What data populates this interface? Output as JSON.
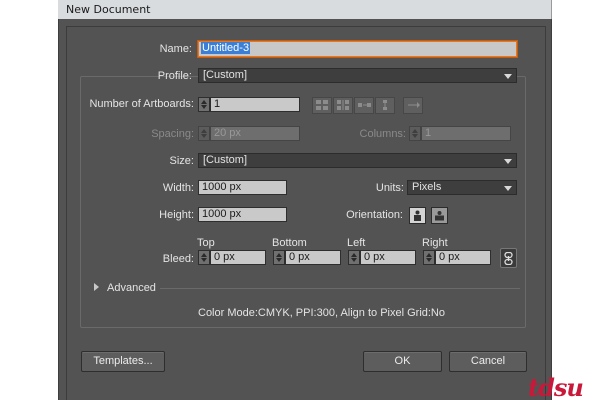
{
  "window": {
    "title": "New Document"
  },
  "name": {
    "label": "Name:",
    "value": "Untitled-3"
  },
  "profile": {
    "label": "Profile:",
    "value": "[Custom]"
  },
  "artboards": {
    "label": "Number of Artboards:",
    "value": "1",
    "spacing_label": "Spacing:",
    "spacing_value": "20 px",
    "columns_label": "Columns:",
    "columns_value": "1"
  },
  "size": {
    "label": "Size:",
    "value": "[Custom]"
  },
  "width": {
    "label": "Width:",
    "value": "1000 px"
  },
  "units": {
    "label": "Units:",
    "value": "Pixels"
  },
  "height": {
    "label": "Height:",
    "value": "1000 px"
  },
  "orientation": {
    "label": "Orientation:"
  },
  "bleed": {
    "label": "Bleed:",
    "top_label": "Top",
    "top_value": "0 px",
    "bottom_label": "Bottom",
    "bottom_value": "0 px",
    "left_label": "Left",
    "left_value": "0 px",
    "right_label": "Right",
    "right_value": "0 px"
  },
  "advanced": {
    "label": "Advanced"
  },
  "summary": "Color Mode:CMYK, PPI:300, Align to Pixel Grid:No",
  "buttons": {
    "templates": "Templates...",
    "ok": "OK",
    "cancel": "Cancel"
  },
  "icons": {
    "grid-by-row": "grid-by-row-icon",
    "grid-by-column": "grid-by-column-icon",
    "arrange-by-row": "arrange-by-row-icon",
    "arrange-by-column": "arrange-by-column-icon",
    "right-to-left": "change-to-right-to-left-icon",
    "portrait": "portrait-icon",
    "landscape": "landscape-icon",
    "link": "link-icon"
  },
  "colors": {
    "dialog": "#535353",
    "focus": "#e07a2a",
    "selection": "#3a7fd5",
    "watermark": "#c8193a"
  }
}
